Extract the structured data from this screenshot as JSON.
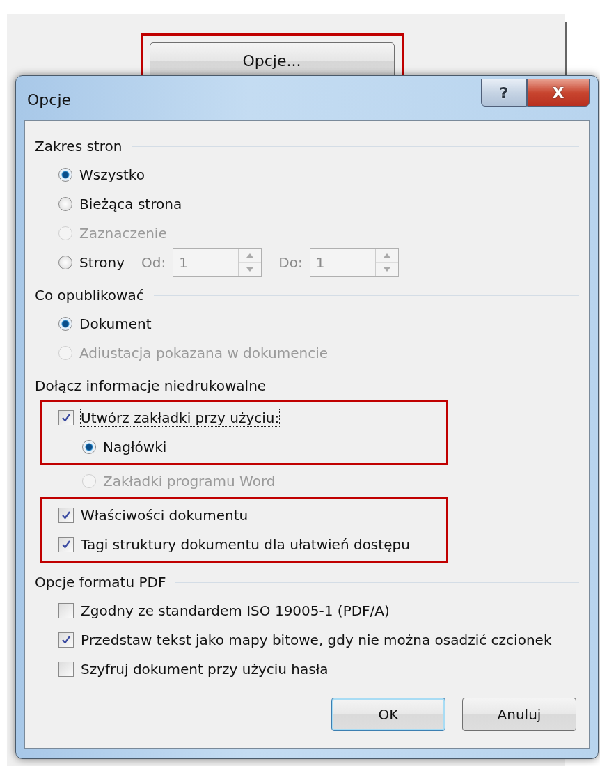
{
  "launch_button": {
    "label": "Opcje...",
    "highlighted": true
  },
  "dialog": {
    "title": "Opcje",
    "help_label": "?",
    "close_label": "X",
    "sections": [
      {
        "heading": "Zakres stron",
        "items": [
          {
            "kind": "radio",
            "label": "Wszystko",
            "selected": true,
            "disabled": false
          },
          {
            "kind": "radio",
            "label": "Bieżąca strona",
            "selected": false,
            "disabled": false
          },
          {
            "kind": "radio",
            "label": "Zaznaczenie",
            "selected": false,
            "disabled": true
          },
          {
            "kind": "range",
            "label": "Strony",
            "selected": false,
            "disabled": false,
            "fields": [
              {
                "label": "Od:",
                "value": "1",
                "disabled": true
              },
              {
                "label": "Do:",
                "value": "1",
                "disabled": true
              }
            ]
          }
        ]
      },
      {
        "heading": "Co opublikować",
        "items": [
          {
            "kind": "radio",
            "label": "Dokument",
            "selected": true,
            "disabled": false
          },
          {
            "kind": "radio",
            "label": "Adiustacja pokazana w dokumencie",
            "selected": false,
            "disabled": true
          }
        ]
      },
      {
        "heading": "Dołącz informacje niedrukowalne",
        "items": [
          {
            "kind": "checkbox",
            "label": "Utwórz zakładki przy użyciu:",
            "checked": true,
            "disabled": false,
            "focused": true,
            "highlighted": true,
            "children": [
              {
                "kind": "radio",
                "label": "Nagłówki",
                "selected": true,
                "disabled": false,
                "highlighted": true
              },
              {
                "kind": "radio",
                "label": "Zakładki programu Word",
                "selected": false,
                "disabled": true,
                "highlighted": false
              }
            ]
          },
          {
            "kind": "checkbox",
            "label": "Właściwości dokumentu",
            "checked": true,
            "disabled": false,
            "highlighted": true
          },
          {
            "kind": "checkbox",
            "label": "Tagi struktury dokumentu dla ułatwień dostępu",
            "checked": true,
            "disabled": false,
            "highlighted": true
          }
        ]
      },
      {
        "heading": "Opcje formatu PDF",
        "items": [
          {
            "kind": "checkbox",
            "label": "Zgodny ze standardem ISO 19005-1 (PDF/A)",
            "checked": false,
            "disabled": false
          },
          {
            "kind": "checkbox",
            "label": "Przedstaw tekst jako mapy bitowe, gdy nie można osadzić czcionek",
            "checked": true,
            "disabled": false
          },
          {
            "kind": "checkbox",
            "label": "Szyfruj dokument przy użyciu hasła",
            "checked": false,
            "disabled": false
          }
        ]
      }
    ],
    "buttons": [
      {
        "label": "OK",
        "default": true
      },
      {
        "label": "Anuluj",
        "default": false
      }
    ]
  }
}
